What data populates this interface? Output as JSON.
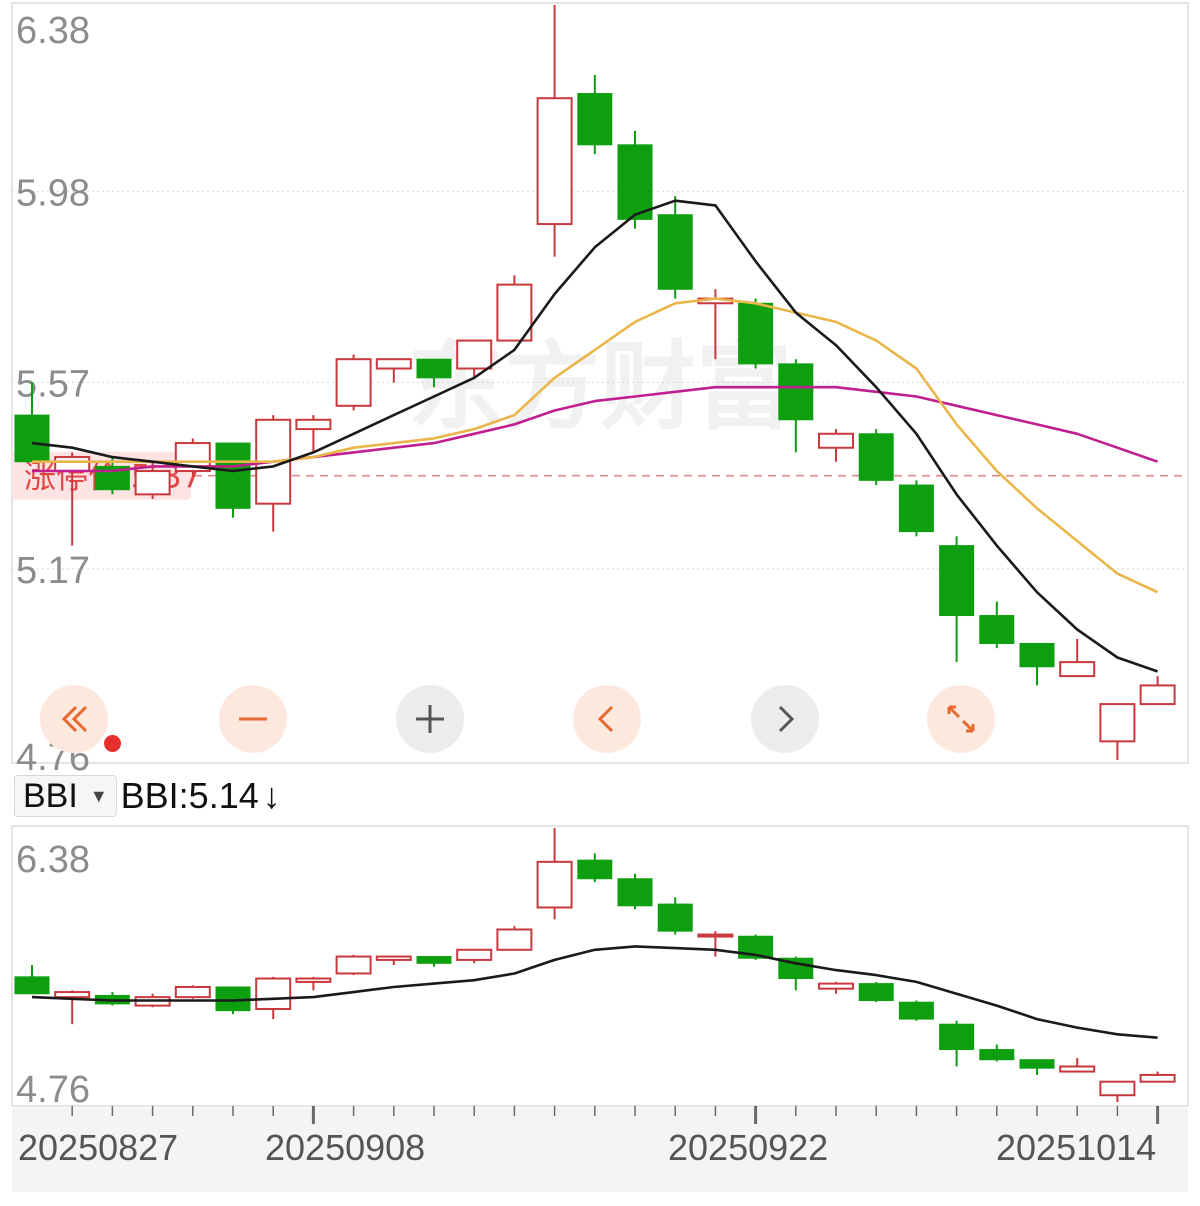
{
  "colors": {
    "up": "#c8383c",
    "down": "#0e9f10",
    "ma5": "#1a1a1a",
    "ma10": "#eab64a",
    "ma20": "#c01f8f",
    "bbi": "#1a1a1a",
    "limit": "#e0898b",
    "limit_bg": "#fde3e3",
    "limit_text": "#e04848",
    "grid": "#d9d9d9",
    "axis_text": "#8c8c8c"
  },
  "main_axis": {
    "ylim": [
      4.76,
      6.38
    ],
    "tick_labels": [
      "6.38",
      "5.98",
      "5.57",
      "5.17",
      "4.76"
    ],
    "tick_values": [
      6.38,
      5.98,
      5.57,
      5.17,
      4.76
    ]
  },
  "limit_price": {
    "label": "涨停价:5.37",
    "value": 5.37
  },
  "watermark": "东方财富",
  "indicator": {
    "selector_label": "BBI",
    "value_text": "BBI:5.14",
    "arrow": "↓"
  },
  "sub_axis": {
    "ylim": [
      4.76,
      6.38
    ],
    "tick_labels": [
      "6.38",
      "4.76"
    ]
  },
  "x_axis": {
    "date_labels": [
      "20250827",
      "20250908",
      "20250922",
      "20251014"
    ],
    "date_label_index": [
      0,
      7,
      18,
      28
    ]
  },
  "controls": [
    {
      "name": "scroll-left-fast-button",
      "icon": "double-chevron-left-icon",
      "style": "orange"
    },
    {
      "name": "zoom-out-button",
      "icon": "minus-icon",
      "style": "orange"
    },
    {
      "name": "zoom-in-button",
      "icon": "plus-icon",
      "style": "gray"
    },
    {
      "name": "scroll-left-button",
      "icon": "chevron-left-icon",
      "style": "orange"
    },
    {
      "name": "scroll-right-button",
      "icon": "chevron-right-icon",
      "style": "gray"
    },
    {
      "name": "fullscreen-button",
      "icon": "expand-icon",
      "style": "orange"
    }
  ],
  "chart_data": {
    "type": "candlestick",
    "ylim": [
      4.76,
      6.38
    ],
    "candles": [
      {
        "o": 5.5,
        "c": 5.4,
        "h": 5.57,
        "l": 5.4
      },
      {
        "o": 5.38,
        "c": 5.41,
        "h": 5.42,
        "l": 5.22
      },
      {
        "o": 5.39,
        "c": 5.34,
        "h": 5.41,
        "l": 5.33
      },
      {
        "o": 5.33,
        "c": 5.38,
        "h": 5.4,
        "l": 5.32
      },
      {
        "o": 5.38,
        "c": 5.44,
        "h": 5.45,
        "l": 5.37
      },
      {
        "o": 5.44,
        "c": 5.3,
        "h": 5.44,
        "l": 5.28
      },
      {
        "o": 5.31,
        "c": 5.49,
        "h": 5.5,
        "l": 5.25
      },
      {
        "o": 5.47,
        "c": 5.49,
        "h": 5.5,
        "l": 5.42
      },
      {
        "o": 5.52,
        "c": 5.62,
        "h": 5.63,
        "l": 5.51
      },
      {
        "o": 5.6,
        "c": 5.62,
        "h": 5.62,
        "l": 5.57
      },
      {
        "o": 5.62,
        "c": 5.58,
        "h": 5.62,
        "l": 5.56
      },
      {
        "o": 5.6,
        "c": 5.66,
        "h": 5.66,
        "l": 5.58
      },
      {
        "o": 5.66,
        "c": 5.78,
        "h": 5.8,
        "l": 5.66
      },
      {
        "o": 5.91,
        "c": 6.18,
        "h": 6.38,
        "l": 5.84
      },
      {
        "o": 6.19,
        "c": 6.08,
        "h": 6.23,
        "l": 6.06
      },
      {
        "o": 6.08,
        "c": 5.92,
        "h": 6.11,
        "l": 5.9
      },
      {
        "o": 5.93,
        "c": 5.77,
        "h": 5.97,
        "l": 5.75
      },
      {
        "o": 5.74,
        "c": 5.75,
        "h": 5.77,
        "l": 5.62
      },
      {
        "o": 5.74,
        "c": 5.61,
        "h": 5.75,
        "l": 5.6
      },
      {
        "o": 5.61,
        "c": 5.49,
        "h": 5.62,
        "l": 5.42
      },
      {
        "o": 5.43,
        "c": 5.46,
        "h": 5.47,
        "l": 5.4
      },
      {
        "o": 5.46,
        "c": 5.36,
        "h": 5.47,
        "l": 5.35
      },
      {
        "o": 5.35,
        "c": 5.25,
        "h": 5.36,
        "l": 5.24
      },
      {
        "o": 5.22,
        "c": 5.07,
        "h": 5.24,
        "l": 4.97
      },
      {
        "o": 5.07,
        "c": 5.01,
        "h": 5.1,
        "l": 5.0
      },
      {
        "o": 5.01,
        "c": 4.96,
        "h": 5.01,
        "l": 4.92
      },
      {
        "o": 4.94,
        "c": 4.97,
        "h": 5.02,
        "l": 4.95
      },
      {
        "o": 4.8,
        "c": 4.88,
        "h": 4.88,
        "l": 4.76
      },
      {
        "o": 4.88,
        "c": 4.92,
        "h": 4.94,
        "l": 4.88
      }
    ],
    "ma5": [
      5.44,
      5.43,
      5.41,
      5.4,
      5.39,
      5.38,
      5.39,
      5.42,
      5.46,
      5.5,
      5.54,
      5.58,
      5.64,
      5.76,
      5.86,
      5.93,
      5.96,
      5.95,
      5.83,
      5.72,
      5.65,
      5.56,
      5.46,
      5.33,
      5.22,
      5.12,
      5.04,
      4.98,
      4.95
    ],
    "ma10": [
      5.4,
      5.4,
      5.4,
      5.4,
      5.4,
      5.4,
      5.4,
      5.41,
      5.43,
      5.44,
      5.45,
      5.47,
      5.5,
      5.58,
      5.64,
      5.7,
      5.74,
      5.75,
      5.74,
      5.72,
      5.7,
      5.66,
      5.6,
      5.48,
      5.38,
      5.3,
      5.23,
      5.16,
      5.12
    ],
    "ma20": [
      5.38,
      5.38,
      5.38,
      5.39,
      5.39,
      5.39,
      5.4,
      5.41,
      5.42,
      5.43,
      5.44,
      5.46,
      5.48,
      5.51,
      5.53,
      5.54,
      5.55,
      5.56,
      5.56,
      5.56,
      5.56,
      5.55,
      5.54,
      5.52,
      5.5,
      5.48,
      5.46,
      5.43,
      5.4
    ],
    "bbi": [
      5.38,
      5.37,
      5.36,
      5.36,
      5.36,
      5.36,
      5.37,
      5.38,
      5.41,
      5.44,
      5.46,
      5.48,
      5.52,
      5.6,
      5.66,
      5.68,
      5.67,
      5.66,
      5.63,
      5.58,
      5.54,
      5.51,
      5.47,
      5.4,
      5.33,
      5.25,
      5.2,
      5.16,
      5.14
    ]
  }
}
